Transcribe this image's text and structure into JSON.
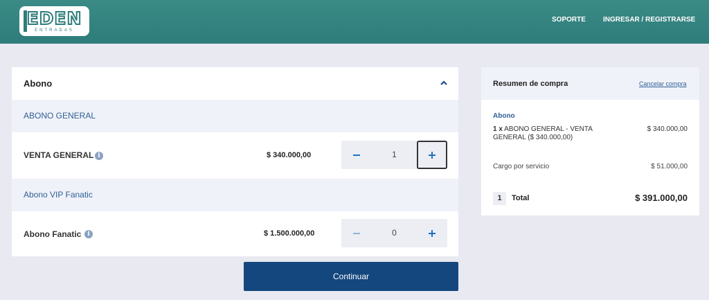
{
  "header": {
    "logo_word": "EDEN",
    "logo_sub": "ENTRADAS",
    "nav": {
      "support": "SOPORTE",
      "login": "INGRESAR / REGISTRARSE"
    }
  },
  "tickets": {
    "section_title": "Abono",
    "groups": [
      {
        "label": "ABONO GENERAL",
        "row": {
          "label": "VENTA GENERAL",
          "price": "$ 340.000,00",
          "quantity": "1"
        }
      },
      {
        "label": "Abono VIP Fanatic",
        "row": {
          "label": "Abono Fanatic",
          "price": "$ 1.500.000,00",
          "quantity": "0"
        }
      }
    ],
    "continue_label": "Continuar"
  },
  "summary": {
    "title": "Resumen de compra",
    "cancel_label": "Cancelar compra",
    "group_label": "Abono",
    "item_qty": "1 x",
    "item_desc": "ABONO GENERAL - VENTA GENERAL ($ 340.000,00)",
    "item_price": "$ 340.000,00",
    "fee_label": "Cargo por servicio",
    "fee_price": "$ 51.000,00",
    "total_count": "1",
    "total_label": "Total",
    "total_price": "$ 391.000,00"
  },
  "icons": {
    "minus": "minus-icon",
    "plus": "plus-icon",
    "info": "info-icon",
    "chevron": "chevron-up-icon"
  },
  "colors": {
    "header": "#2f7d7a",
    "primary": "#14477d",
    "accent": "#1f6fc4",
    "background": "#e8e9f1"
  }
}
